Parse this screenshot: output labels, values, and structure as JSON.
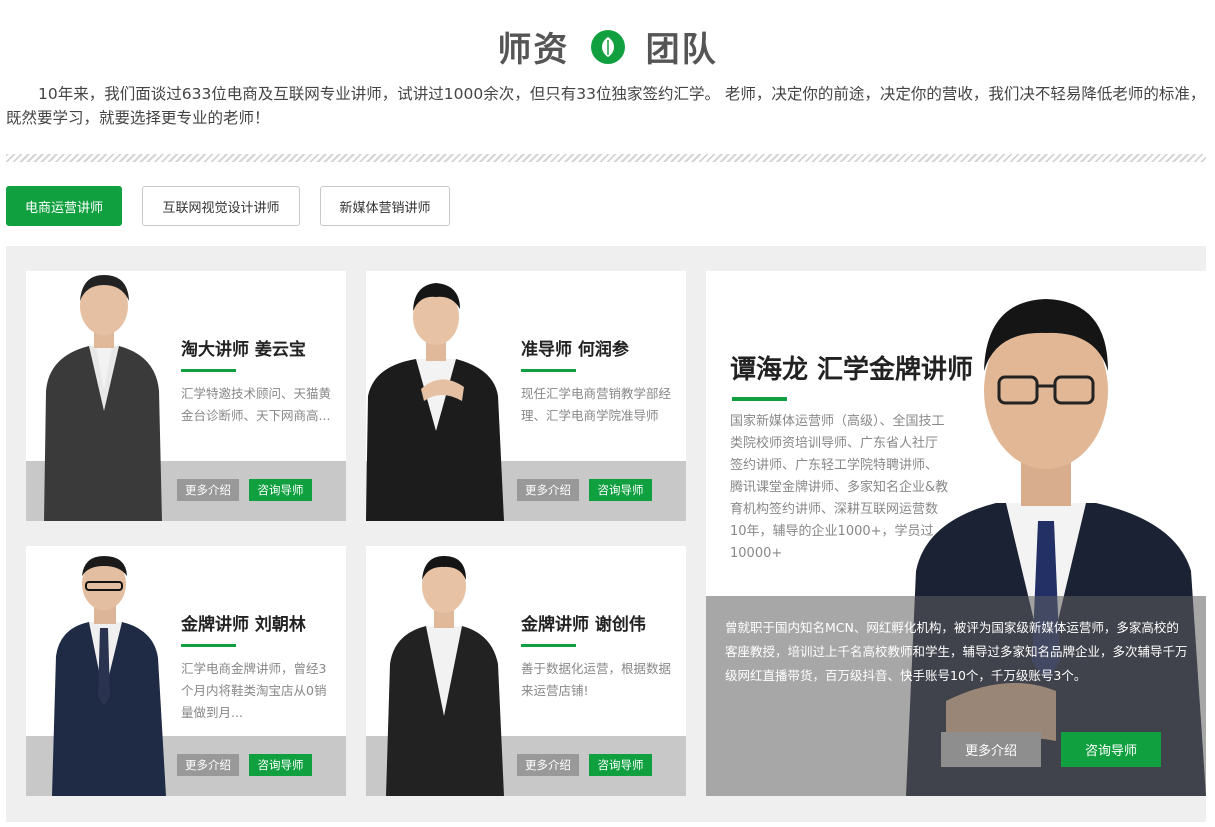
{
  "header": {
    "title_left": "师资",
    "title_right": "团队",
    "title_icon": "leaf-icon",
    "intro": "10年来，我们面谈过633位电商及互联网专业讲师，试讲过1000余次，但只有33位独家签约汇学。 老师，决定你的前途，决定你的营收，我们决不轻易降低老师的标准，既然要学习，就要选择更专业的老师！"
  },
  "tabs": [
    {
      "label": "电商运营讲师",
      "active": true
    },
    {
      "label": "互联网视觉设计讲师",
      "active": false
    },
    {
      "label": "新媒体营销讲师",
      "active": false
    }
  ],
  "cards": [
    {
      "name": "淘大讲师 姜云宝",
      "desc": "汇学特邀技术顾问、天猫黄金台诊断师、天下网商高...",
      "more": "更多介绍",
      "consult": "咨询导师"
    },
    {
      "name": "准导师 何润参",
      "desc": "现任汇学电商营销教学部经理、汇学电商学院准导师",
      "more": "更多介绍",
      "consult": "咨询导师"
    },
    {
      "name": "金牌讲师 刘朝林",
      "desc": "汇学电商金牌讲师，曾经3个月内将鞋类淘宝店从0销量做到月...",
      "more": "更多介绍",
      "consult": "咨询导师"
    },
    {
      "name": "金牌讲师 谢创伟",
      "desc": "善于数据化运营，根据数据来运营店铺!",
      "more": "更多介绍",
      "consult": "咨询导师"
    }
  ],
  "feature": {
    "name": "谭海龙 汇学金牌讲师",
    "desc": "国家新媒体运营师（高级）、全国技工类院校师资培训导师、广东省人社厅签约讲师、广东轻工学院特聘讲师、腾讯课堂金牌讲师、多家知名企业&教育机构签约讲师、深耕互联网运营数10年，辅导的企业1000+，学员过10000+",
    "detail": "曾就职于国内知名MCN、网红孵化机构，被评为国家级新媒体运营师，多家高校的客座教授，培训过上千名高校教师和学生，辅导过多家知名品牌企业，多次辅导千万级网红直播带货，百万级抖音、快手账号10个，千万级账号3个。",
    "more": "更多介绍",
    "consult": "咨询导师"
  },
  "colors": {
    "accent": "#10a040",
    "band": "#c8c8c8",
    "panel": "#efefef"
  }
}
